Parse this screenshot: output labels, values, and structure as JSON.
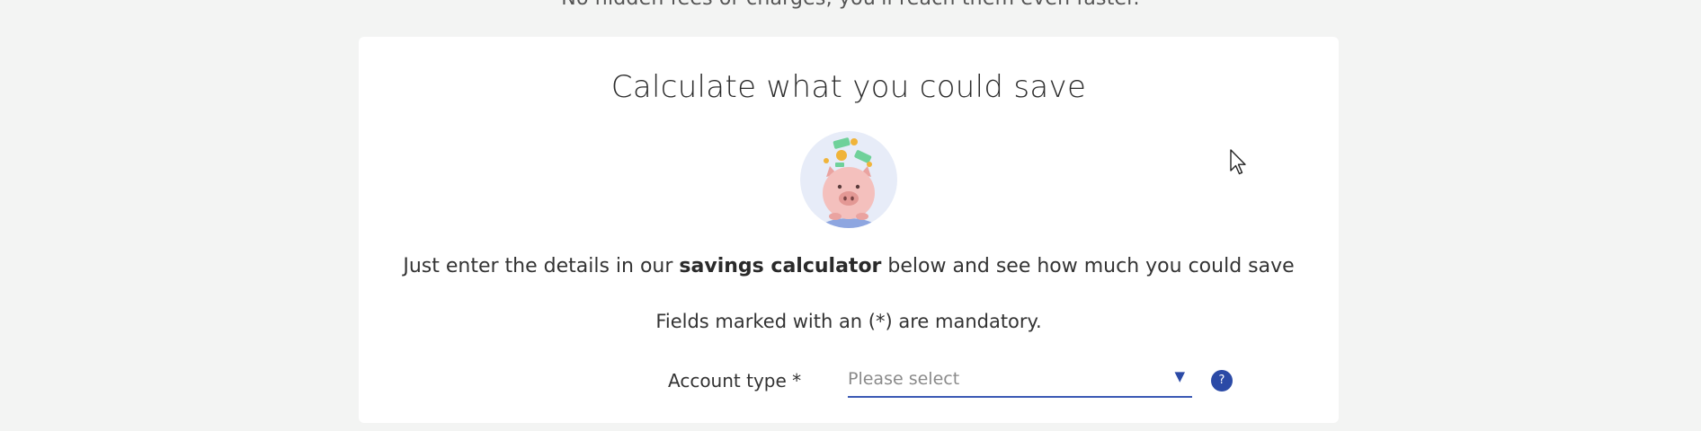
{
  "top_partial_text": "No hidden fees or charges, you'll reach them even faster.",
  "calculator": {
    "title": "Calculate what you could save",
    "intro_before": "Just enter the details in our ",
    "intro_bold": "savings calculator",
    "intro_after": " below and see how much you could save",
    "mandatory_note": "Fields marked with an (*) are mandatory.",
    "account_type": {
      "label": "Account type *",
      "placeholder": "Please select",
      "arrow_icon": "triangle-down",
      "help_text": "?"
    },
    "illustration_icon": "piggy-bank-with-coins",
    "accent_color": "#2b4aa6"
  }
}
